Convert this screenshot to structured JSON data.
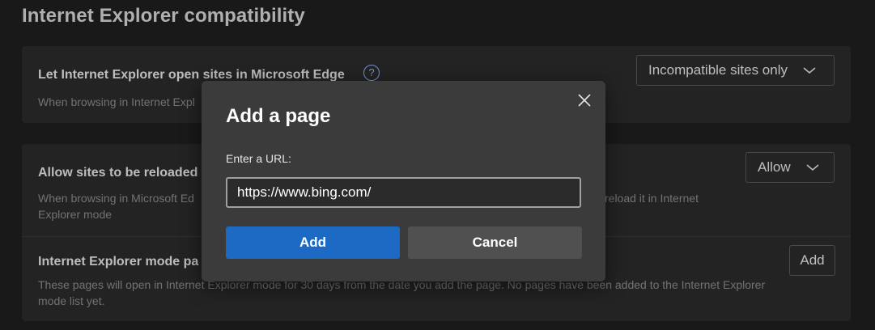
{
  "page": {
    "title": "Internet Explorer compatibility"
  },
  "settings": {
    "open_in_edge": {
      "title": "Let Internet Explorer open sites in Microsoft Edge",
      "description": "When browsing in Internet Expl",
      "dropdown_value": "Incompatible sites only",
      "help_icon": "?"
    },
    "reload_ie_mode": {
      "title": "Allow sites to be reloaded",
      "description_line1": "When browsing in Microsoft Ed",
      "description_line1_tail": "reload it in Internet",
      "description_line2": "Explorer mode",
      "dropdown_value": "Allow"
    },
    "ie_mode_pages": {
      "title": "Internet Explorer mode pa",
      "description": "These pages will open in Internet Explorer mode for 30 days from the date you add the page. No pages have been added to the Internet Explorer mode list yet.",
      "add_label": "Add"
    }
  },
  "dialog": {
    "title": "Add a page",
    "url_label": "Enter a URL:",
    "url_value": "https://www.bing.com/",
    "add_label": "Add",
    "cancel_label": "Cancel",
    "close_icon": "close-icon"
  },
  "colors": {
    "primary": "#1c6ac4",
    "background": "#1f1f1f",
    "card": "#2b2b2b",
    "dialog": "#3b3b3b"
  }
}
